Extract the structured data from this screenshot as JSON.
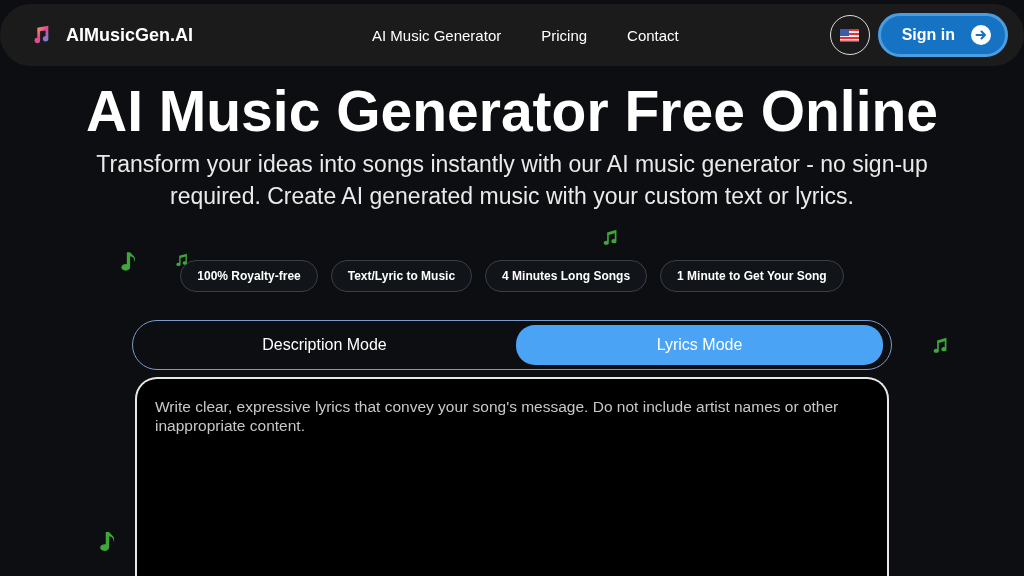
{
  "nav": {
    "brand": "AIMusicGen.AI",
    "links": [
      "AI Music Generator",
      "Pricing",
      "Contact"
    ],
    "sign_in": "Sign in"
  },
  "hero": {
    "title": "AI Music Generator Free Online",
    "subtitle": "Transform your ideas into songs instantly with our AI music generator - no sign-up required. Create AI generated music with your custom text or lyrics."
  },
  "features": [
    "100% Royalty-free",
    "Text/Lyric to Music",
    "4 Minutes Long Songs",
    "1 Minute to Get Your Song"
  ],
  "modes": [
    {
      "label": "Description Mode",
      "selected": false
    },
    {
      "label": "Lyrics Mode",
      "selected": true
    }
  ],
  "lyrics_field": {
    "placeholder": "Write clear, expressive lyrics that convey your song's message. Do not include artist names or other inappropriate content."
  }
}
